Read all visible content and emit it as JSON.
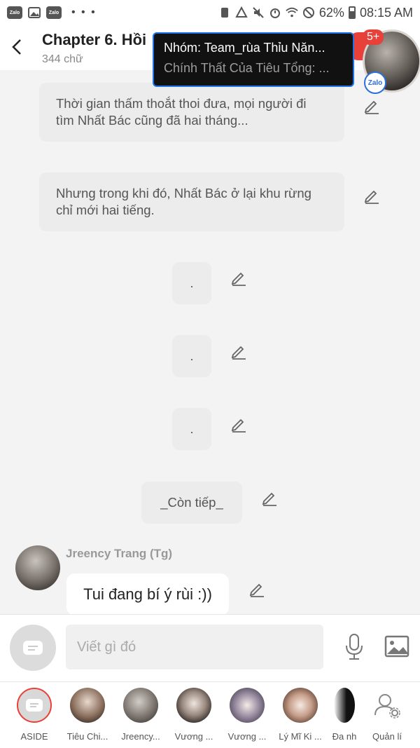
{
  "status_bar": {
    "app_icons": [
      "Zalo",
      "gallery-icon",
      "Zalo"
    ],
    "more": "• • •",
    "battery": "62%",
    "time": "08:15 AM"
  },
  "header": {
    "title": "Chapter 6. Hồi",
    "subtitle": "344 chữ",
    "badge_count": "5+"
  },
  "notification": {
    "title": "Nhóm: Team_rùa Thỉu Năn...",
    "text": "Chính Thất Của Tiêu Tổng: ..."
  },
  "messages": [
    "Thời gian thấm thoắt thoi đưa, mọi người đi tìm Nhất Bác cũng đã hai tháng...",
    "Nhưng trong khi đó, Nhất Bác ở lại khu rừng chỉ mới hai tiếng.",
    ".",
    ".",
    ".",
    "_Còn tiếp_"
  ],
  "comment": {
    "author": "Jreency Trang (Tg)",
    "text": "Tui đang bí ý rùi :))"
  },
  "composer": {
    "placeholder": "Viết gì đó"
  },
  "bottom_bar": [
    {
      "label": "ASIDE"
    },
    {
      "label": "Tiêu Chi..."
    },
    {
      "label": "Jreency..."
    },
    {
      "label": "Vương ..."
    },
    {
      "label": "Vương ..."
    },
    {
      "label": "Lý Mĩ Ki ..."
    },
    {
      "label": "Đa nh"
    },
    {
      "label": "Quản lí"
    }
  ],
  "colors": {
    "accent_red": "#e8413a",
    "zalo_blue": "#1e74e8"
  }
}
